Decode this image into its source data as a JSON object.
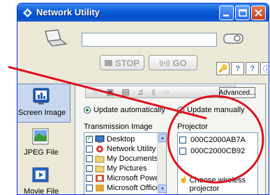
{
  "window": {
    "title": "Network Utility"
  },
  "toolbar": {
    "stop_label": "STOP",
    "go_label": "GO",
    "go_prefix": "((•))"
  },
  "sidebar": {
    "items": [
      {
        "label": "Screen Image",
        "active": true
      },
      {
        "label": "JPEG File",
        "active": false
      },
      {
        "label": "Movie File",
        "active": false
      }
    ]
  },
  "panel": {
    "advanced_label": "Advanced...",
    "update_auto": "Update automatically",
    "update_manual": "Update manually",
    "transmission_label": "Transmission Image",
    "projector_label": "Projector",
    "transmission_items": [
      {
        "label": "Desktop",
        "checked": true,
        "icon": "desktop-icon"
      },
      {
        "label": "Network Utility",
        "checked": false,
        "icon": "app-icon"
      },
      {
        "label": "My Documents",
        "checked": false,
        "icon": "folder-icon"
      },
      {
        "label": "My Pictures",
        "checked": false,
        "icon": "folder-icon"
      },
      {
        "label": "Microsoft Power",
        "checked": false,
        "icon": "powerpoint-icon"
      },
      {
        "label": "Microsoft Office",
        "checked": false,
        "icon": "office-icon"
      }
    ],
    "projectors": [
      {
        "label": "000C2000AB7A",
        "checked": false
      },
      {
        "label": "000C2000CB92",
        "checked": false
      }
    ],
    "choose_label": "Choose wireless projector"
  },
  "colors": {
    "callout": "#e0101c",
    "title_bar": "#0a5bd9",
    "accent_active": "#c8d7ee"
  }
}
